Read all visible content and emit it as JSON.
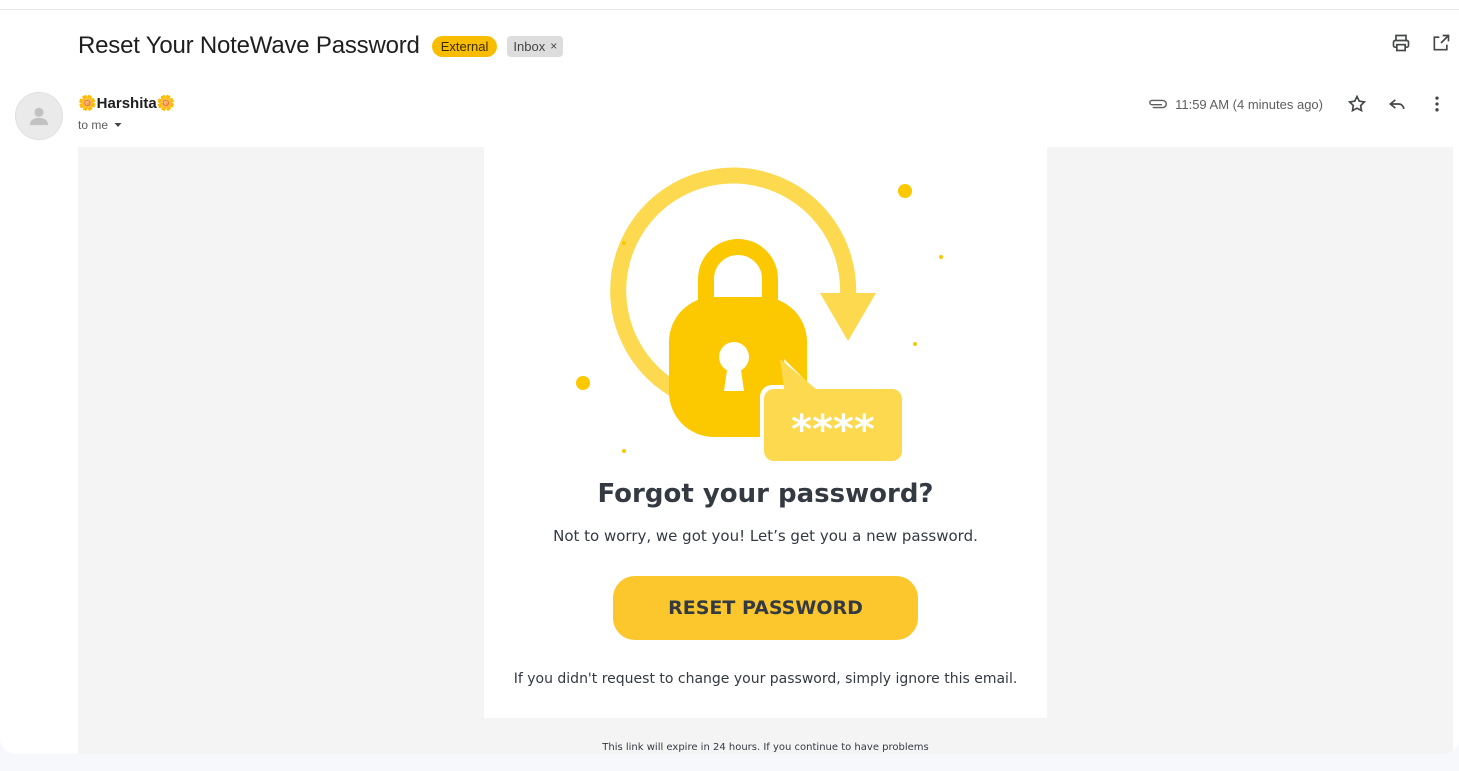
{
  "email": {
    "subject": "Reset Your NoteWave Password",
    "labels": {
      "external": "External",
      "inbox": "Inbox",
      "inbox_remove": "×"
    },
    "sender_name": "🌼Harshita🌼",
    "recipient": "to me",
    "timestamp": "11:59 AM (4 minutes ago)"
  },
  "body": {
    "headline": "Forgot your password?",
    "subtext": "Not to worry, we got you! Let’s get you a new password.",
    "button_label": "RESET PASSWORD",
    "ignore_note": "If you didn't request to change your password, simply ignore this email.",
    "footer_note": "This link will expire in 24 hours. If you continue to have problems",
    "illustration_code": "****"
  },
  "icons": [
    "print-icon",
    "open-in-new-window-icon",
    "avatar-icon",
    "attachment-icon",
    "star-icon",
    "reply-icon",
    "more-vert-icon",
    "dropdown-icon"
  ],
  "colors": {
    "accent_yellow": "#fcc72c",
    "external_label": "#f9bd00",
    "lock_yellow": "#fcc800",
    "text_dark": "#333a42"
  }
}
